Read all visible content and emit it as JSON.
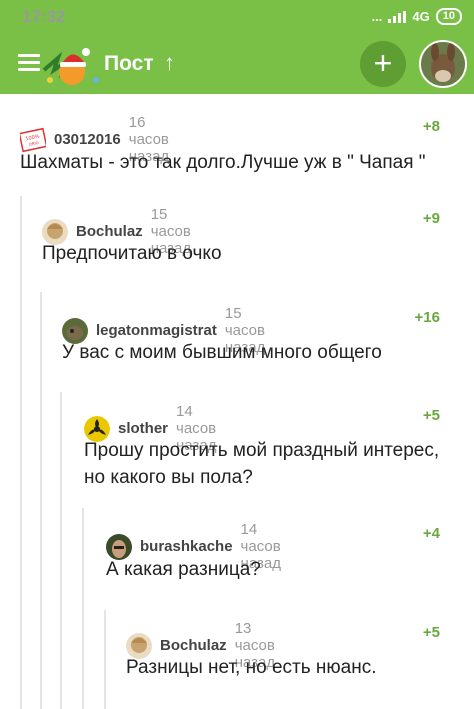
{
  "status": {
    "time": "17:32",
    "dots": "...",
    "network": "4G",
    "battery": "10"
  },
  "appbar": {
    "title": "Пост",
    "colors": {
      "bar": "#7ac046",
      "add_button": "#5e9e33",
      "rating": "#6aa83f"
    }
  },
  "comments": [
    {
      "author": "03012016",
      "time": "16 часов назад",
      "rating": "+8",
      "text": "Шахматы - это так долго.Лучше уж в \" Чапая \""
    },
    {
      "author": "Bochulaz",
      "time": "15 часов назад",
      "rating": "+9",
      "text": "Предпочитаю в очко"
    },
    {
      "author": "legatonmagistrat",
      "time": "15 часов назад",
      "rating": "+16",
      "text": "У вас с моим бывшим много общего"
    },
    {
      "author": "slother",
      "time": "14 часов назад",
      "rating": "+5",
      "text": "Прошу простить мой праздный интерес, но какого вы пола?"
    },
    {
      "author": "burashkache",
      "time": "14 часов назад",
      "rating": "+4",
      "text": "А какая разница?"
    },
    {
      "author": "Bochulaz",
      "time": "13 часов назад",
      "rating": "+5",
      "text": "Разницы нет, но есть нюанс."
    }
  ]
}
